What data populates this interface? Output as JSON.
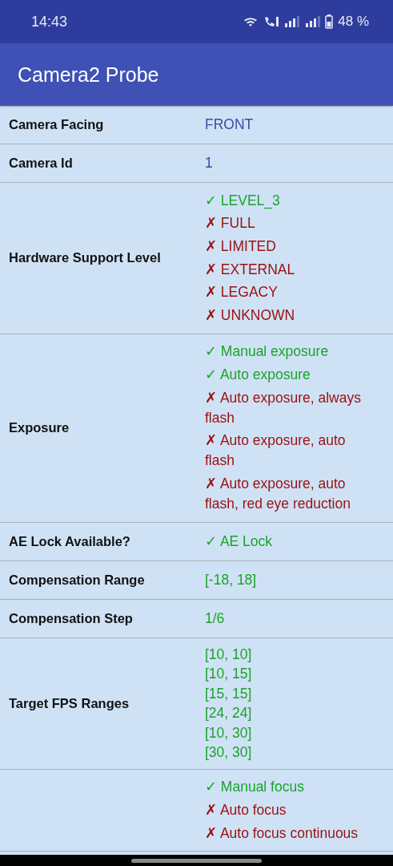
{
  "status_bar": {
    "time": "14:43",
    "battery": "48 %"
  },
  "app_bar": {
    "title": "Camera2 Probe"
  },
  "rows": [
    {
      "label": "Camera Facing",
      "values": [
        {
          "kind": "info",
          "text": "FRONT"
        }
      ]
    },
    {
      "label": "Camera Id",
      "values": [
        {
          "kind": "info",
          "text": "1"
        }
      ]
    },
    {
      "label": "Hardware Support Level",
      "values": [
        {
          "kind": "yes",
          "text": "✓ LEVEL_3"
        },
        {
          "kind": "no",
          "text": "✗ FULL"
        },
        {
          "kind": "no",
          "text": "✗ LIMITED"
        },
        {
          "kind": "no",
          "text": "✗ EXTERNAL"
        },
        {
          "kind": "no",
          "text": "✗ LEGACY"
        },
        {
          "kind": "no",
          "text": "✗ UNKNOWN"
        }
      ]
    },
    {
      "label": "Exposure",
      "values": [
        {
          "kind": "yes",
          "text": "✓ Manual exposure"
        },
        {
          "kind": "yes",
          "text": "✓ Auto exposure"
        },
        {
          "kind": "no",
          "text": "✗ Auto exposure, always flash"
        },
        {
          "kind": "no",
          "text": "✗ Auto exposure, auto flash"
        },
        {
          "kind": "no",
          "text": "✗ Auto exposure, auto flash, red eye reduction"
        }
      ]
    },
    {
      "label": "AE Lock Available?",
      "values": [
        {
          "kind": "yes",
          "text": "✓ AE Lock"
        }
      ]
    },
    {
      "label": "Compensation Range",
      "values": [
        {
          "kind": "yes",
          "text": "[-18, 18]"
        }
      ]
    },
    {
      "label": "Compensation Step",
      "values": [
        {
          "kind": "yes",
          "text": "1/6"
        }
      ]
    },
    {
      "label": "Target FPS Ranges",
      "compact": true,
      "values": [
        {
          "kind": "yes",
          "text": "[10, 10]"
        },
        {
          "kind": "yes",
          "text": "[10, 15]"
        },
        {
          "kind": "yes",
          "text": "[15, 15]"
        },
        {
          "kind": "yes",
          "text": "[24, 24]"
        },
        {
          "kind": "yes",
          "text": "[10, 30]"
        },
        {
          "kind": "yes",
          "text": "[30, 30]"
        }
      ]
    },
    {
      "values": [
        {
          "kind": "yes",
          "text": "✓ Manual focus"
        },
        {
          "kind": "no",
          "text": "✗ Auto focus"
        },
        {
          "kind": "no",
          "text": "✗ Auto focus continuous"
        }
      ]
    }
  ]
}
